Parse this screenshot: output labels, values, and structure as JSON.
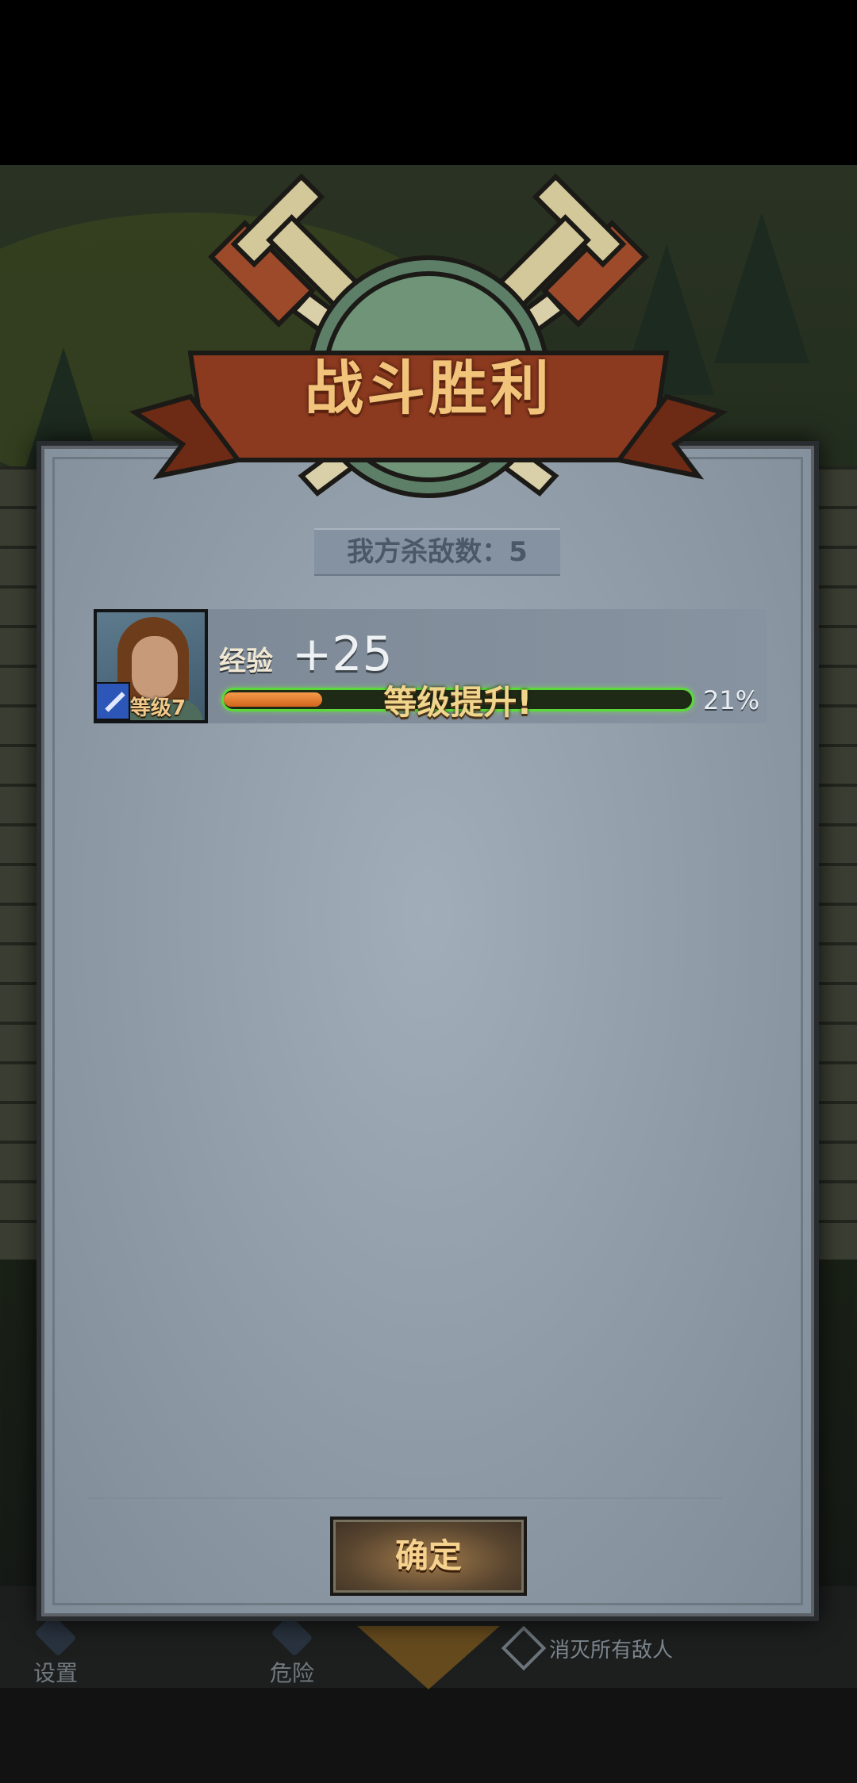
{
  "title": "战斗胜利",
  "kills": {
    "text": "我方杀敌数：5"
  },
  "hero": {
    "level_label": "等级7",
    "exp_label": "经验",
    "exp_gain": "+25",
    "level_up_text": "等级提升!",
    "exp_progress_percent": "21%",
    "exp_progress_fraction": 0.21
  },
  "confirm_button": {
    "label": "确定"
  },
  "bottom_nav": {
    "settings_label": "设置",
    "danger_label": "危险",
    "objective_text": "消灭所有敌人"
  },
  "icons": {
    "emblem": "crossed-swords-shield-icon",
    "class": "sword-class-icon",
    "settings": "gear-icon",
    "danger": "danger-icon",
    "objective": "crossed-swords-icon"
  },
  "colors": {
    "title": "#f2c37a",
    "exp_bar_glow": "#5bd93a",
    "exp_bar_fill": "#f59a4a",
    "button_text": "#f7d28e"
  }
}
